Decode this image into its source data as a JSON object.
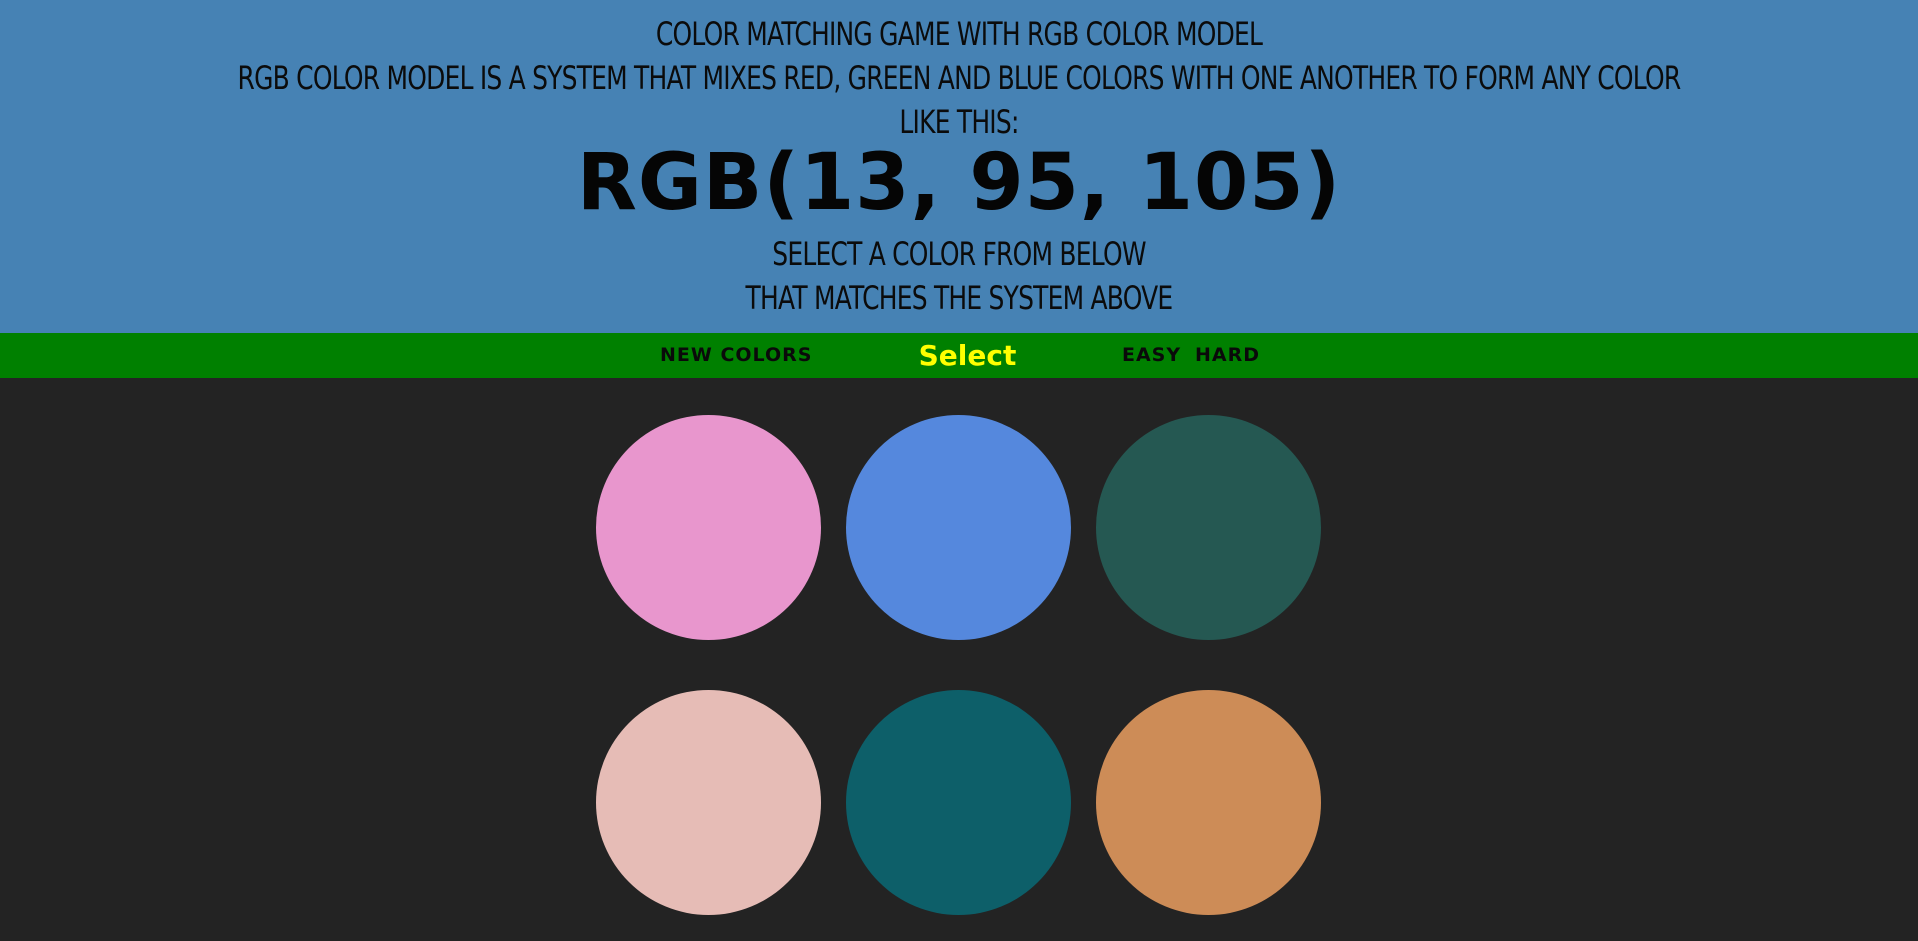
{
  "header": {
    "title": "COLOR MATCHING GAME WITH RGB COLOR MODEL",
    "description": "RGB COLOR MODEL IS A SYSTEM THAT MIXES RED, GREEN AND BLUE COLORS WITH ONE ANOTHER TO FORM ANY COLOR",
    "description_cont": "LIKE THIS:",
    "rgb_display": "RGB(13, 95, 105)",
    "instruction_1": "SELECT A COLOR FROM BELOW",
    "instruction_2": "THAT MATCHES THE SYSTEM ABOVE",
    "background_color": "#4682b4"
  },
  "stripe": {
    "new_colors_label": "NEW COLORS",
    "message": "Select",
    "easy_label": "EASY",
    "hard_label": "HARD",
    "background_color": "#008000",
    "message_color": "#ffff00"
  },
  "swatches": [
    {
      "color": "#e896cd"
    },
    {
      "color": "#5588dd"
    },
    {
      "color": "#255852"
    },
    {
      "color": "#e6bcb6"
    },
    {
      "color": "#0d5f69"
    },
    {
      "color": "#cd8c57"
    }
  ],
  "page_background": "#232323"
}
